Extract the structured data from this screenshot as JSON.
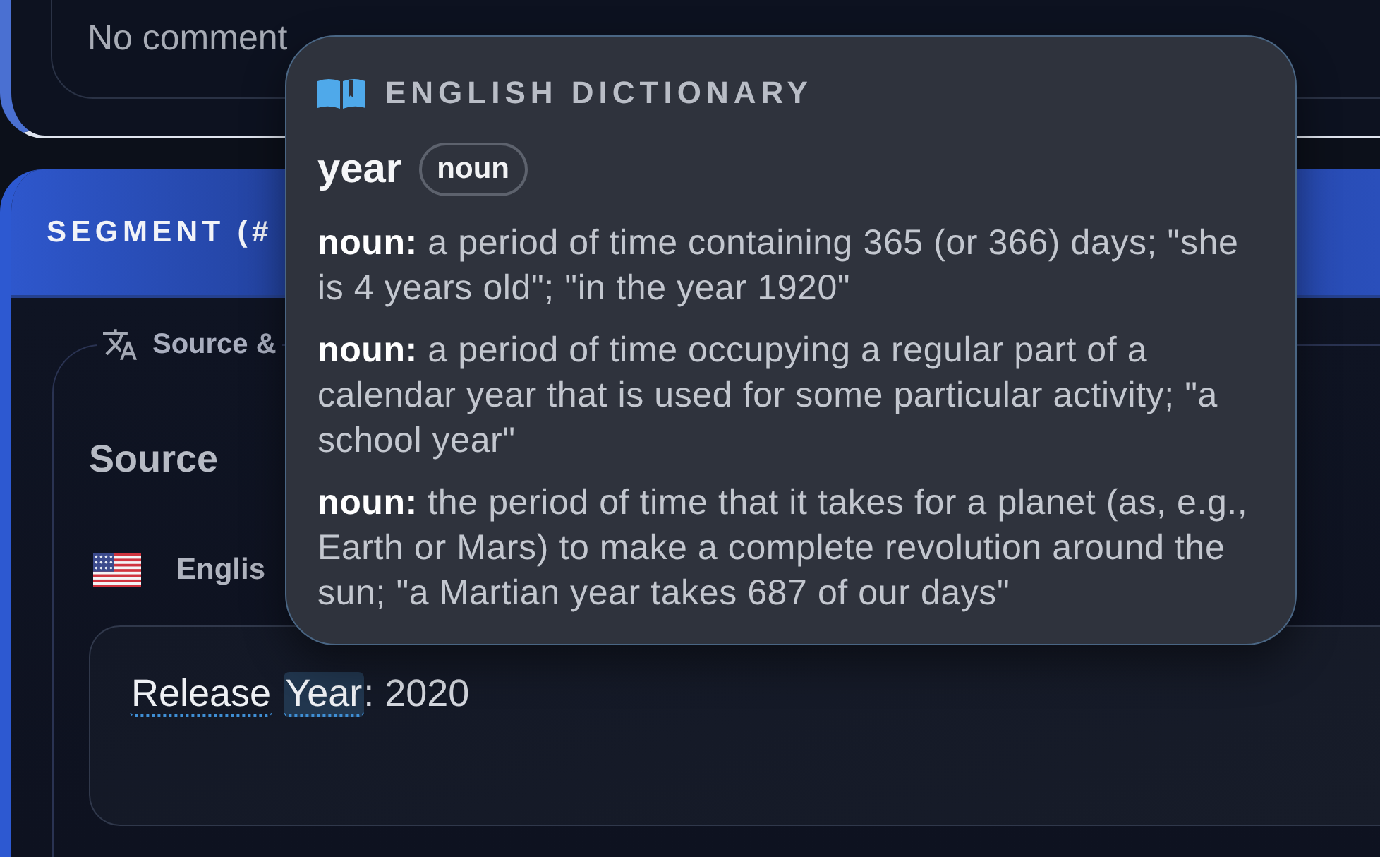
{
  "comments_card": {
    "text": "No comment"
  },
  "segment_card": {
    "title": "SEGMENT (#",
    "source_frame": {
      "legend": "Source &",
      "heading": "Source",
      "language": "Englis",
      "tokens": [
        {
          "text": "Release",
          "kind": "term",
          "selected": false,
          "space_after": true
        },
        {
          "text": "Year",
          "kind": "term",
          "selected": true,
          "space_after": false
        },
        {
          "text": ": 2020",
          "kind": "plain",
          "selected": false,
          "space_after": false
        }
      ]
    }
  },
  "dictionary_popup": {
    "title": "ENGLISH DICTIONARY",
    "headword": "year",
    "part_of_speech": "noun",
    "definitions": [
      "**noun:** a period of time containing 365 (or 366) days; \"she is 4 years old\"; \"in the year 1920\"",
      "**noun:** a period of time occupying a regular part of a calendar year that is used for some particular activity; \"a school year\"",
      "**noun:** the period of time that it takes for a planet (as, e.g., Earth or Mars) to make a complete revolution around the sun; \"a Martian year takes 687 of our days\""
    ]
  }
}
